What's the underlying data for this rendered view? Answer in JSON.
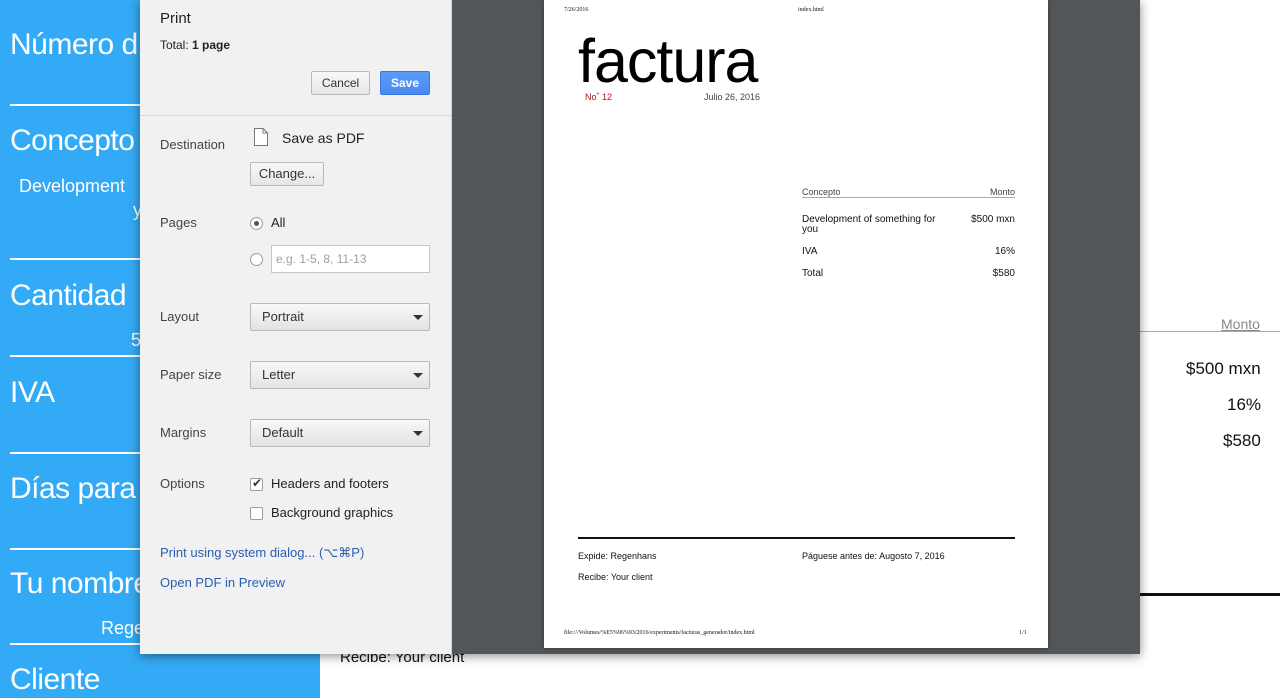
{
  "background": {
    "sidebar_labels": [
      "Número d",
      "Concepto",
      "Cantidad",
      "IVA",
      "Días para",
      "Tu nombre",
      "Cliente"
    ],
    "concept_value_partial": "Development",
    "concept_value_wrap": "y",
    "quantity_partial": "5",
    "name_partial": "Rege",
    "doc": {
      "monto_header": "Monto",
      "amount": "$500 mxn",
      "iva": "16%",
      "total": "$580",
      "recibe": "Recibe: Your client"
    }
  },
  "dialog": {
    "title": "Print",
    "total_label": "Total:",
    "total_value": "1 page",
    "cancel_label": "Cancel",
    "save_label": "Save",
    "destination_label": "Destination",
    "destination_value": "Save as PDF",
    "change_label": "Change...",
    "pages_label": "Pages",
    "pages_all_label": "All",
    "pages_placeholder": "e.g. 1-5, 8, 11-13",
    "layout_label": "Layout",
    "layout_value": "Portrait",
    "paper_size_label": "Paper size",
    "paper_size_value": "Letter",
    "margins_label": "Margins",
    "margins_value": "Default",
    "options_label": "Options",
    "headers_footers_label": "Headers and footers",
    "headers_footers_checked": true,
    "background_graphics_label": "Background graphics",
    "background_graphics_checked": false,
    "system_dialog_link": "Print using system dialog... (⌥⌘P)",
    "open_pdf_link": "Open PDF in Preview"
  },
  "preview_page": {
    "header_date": "7/26/2016",
    "header_file": "index.html",
    "title": "factura",
    "number_label": "No˚ 12",
    "date": "Julio 26, 2016",
    "table": {
      "col_concept": "Concepto",
      "col_amount": "Monto",
      "rows": [
        {
          "concept": "Development of something for you",
          "amount": "$500 mxn"
        },
        {
          "concept": "IVA",
          "amount": "16%"
        },
        {
          "concept": "Total",
          "amount": "$580"
        }
      ]
    },
    "expide": "Expide: Regenhans",
    "paguese": "Páguese antes de: Augosto 7, 2016",
    "recibe": "Recibe: Your client",
    "footer_path": "file:///Volumes/%E5%96%93/2016/experiments/facturas_generador/index.html",
    "footer_page": "1/1"
  }
}
